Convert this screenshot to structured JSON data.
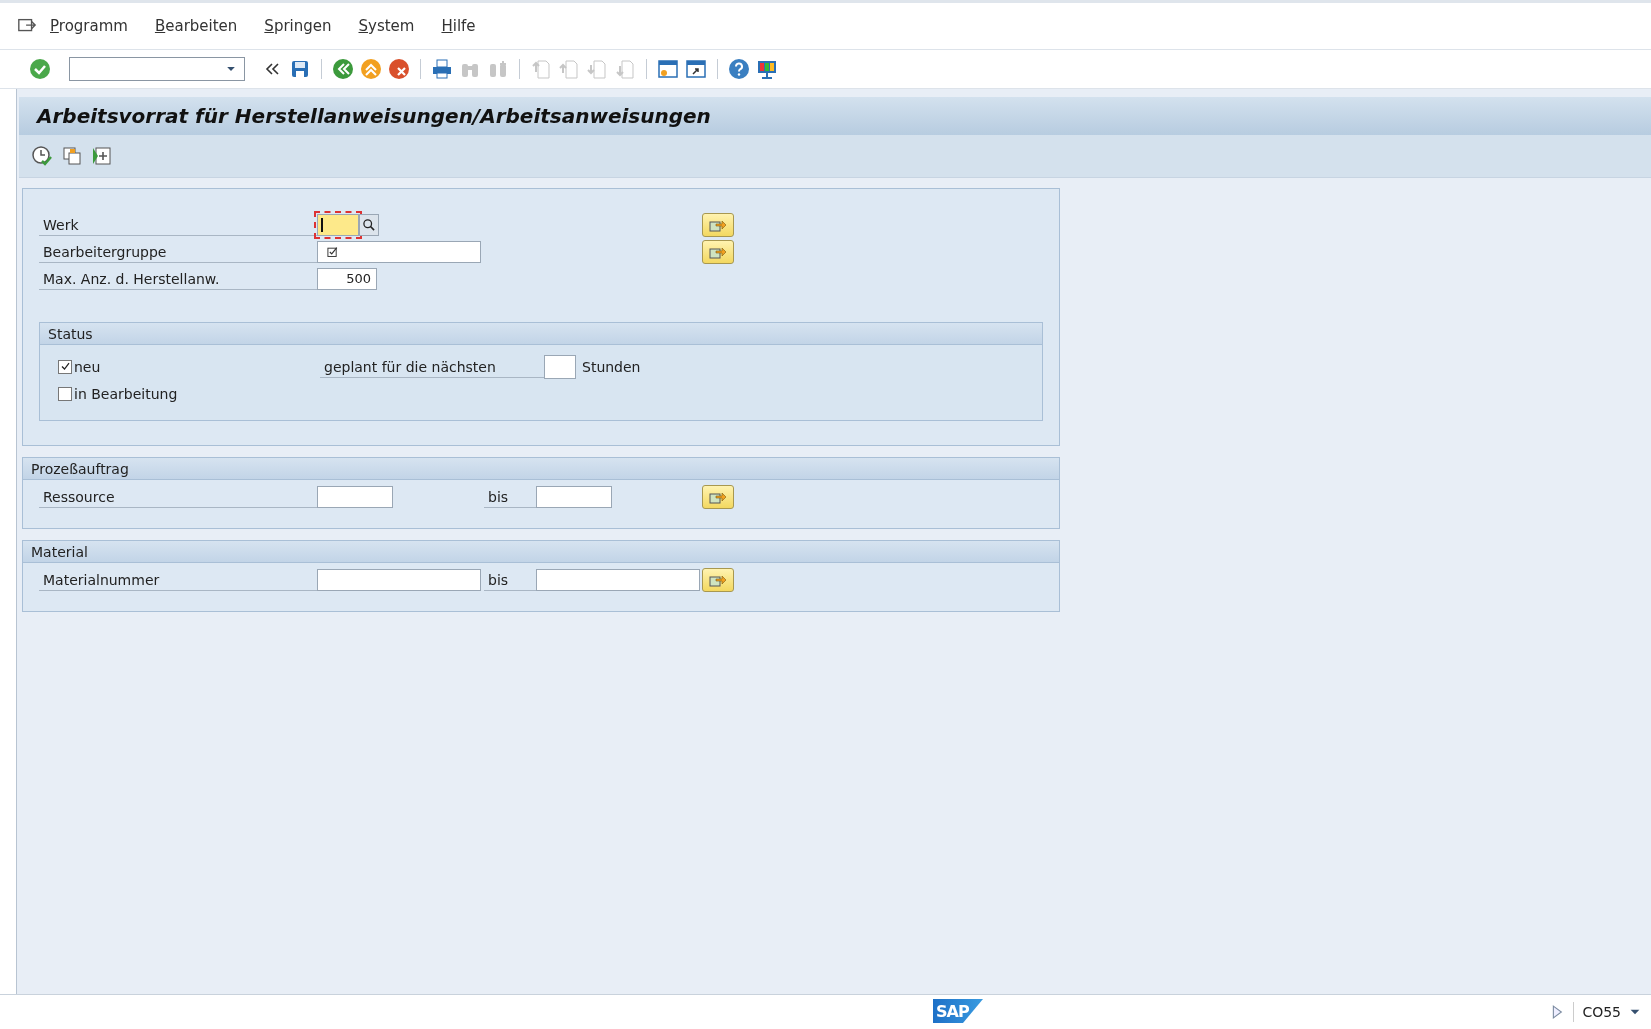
{
  "menu": [
    {
      "label": "Programm"
    },
    {
      "label": "Bearbeiten"
    },
    {
      "label": "Springen"
    },
    {
      "label": "System"
    },
    {
      "label": "Hilfe"
    }
  ],
  "toolbar": [
    {
      "kind": "enter",
      "disabled": false
    },
    {
      "kind": "command-field"
    },
    {
      "kind": "collapse",
      "disabled": false
    },
    {
      "kind": "save",
      "disabled": false
    },
    {
      "kind": "sep",
      "disabled": false
    },
    {
      "kind": "back",
      "disabled": false
    },
    {
      "kind": "exit",
      "disabled": false
    },
    {
      "kind": "cancel",
      "disabled": false
    },
    {
      "kind": "sep",
      "disabled": false
    },
    {
      "kind": "print",
      "disabled": false
    },
    {
      "kind": "find",
      "disabled": true
    },
    {
      "kind": "find-next",
      "disabled": true
    },
    {
      "kind": "sep",
      "disabled": false
    },
    {
      "kind": "first-page",
      "disabled": true
    },
    {
      "kind": "prev-page",
      "disabled": true
    },
    {
      "kind": "next-page",
      "disabled": true
    },
    {
      "kind": "last-page",
      "disabled": true
    },
    {
      "kind": "sep",
      "disabled": false
    },
    {
      "kind": "new-session",
      "disabled": false
    },
    {
      "kind": "shortcut",
      "disabled": false
    },
    {
      "kind": "sep",
      "disabled": false
    },
    {
      "kind": "help",
      "disabled": false
    },
    {
      "kind": "layout",
      "disabled": false
    }
  ],
  "title": "Arbeitsvorrat für Herstellanweisungen/Arbeitsanweisungen",
  "app_toolbar": [
    {
      "kind": "execute"
    },
    {
      "kind": "variant"
    },
    {
      "kind": "selection"
    }
  ],
  "fields": [
    {
      "label": "Werk",
      "kind": "search",
      "focused": true,
      "required": false,
      "multiple": true
    },
    {
      "label": "Bearbeitergruppe",
      "kind": "wide",
      "focused": false,
      "required": true,
      "multiple": true
    },
    {
      "label": "Max. Anz. d. Herstellanw.",
      "kind": "number",
      "value": "500",
      "focused": false,
      "required": false,
      "multiple": false
    }
  ],
  "status": {
    "title": "Status",
    "checkboxes": [
      {
        "label": "neu",
        "checked": true
      },
      {
        "label": "in Bearbeitung",
        "checked": false
      }
    ],
    "planned_label": "geplant für die nächsten",
    "planned_unit": "Stunden"
  },
  "groups": [
    {
      "title": "Prozeßauftrag",
      "label": "Ressource",
      "kind": "short",
      "to_label": "bis"
    },
    {
      "title": "Material",
      "label": "Materialnummer",
      "kind": "wide",
      "to_label": "bis"
    }
  ],
  "footer": {
    "logo": "SAP",
    "transaction": "CO55"
  }
}
